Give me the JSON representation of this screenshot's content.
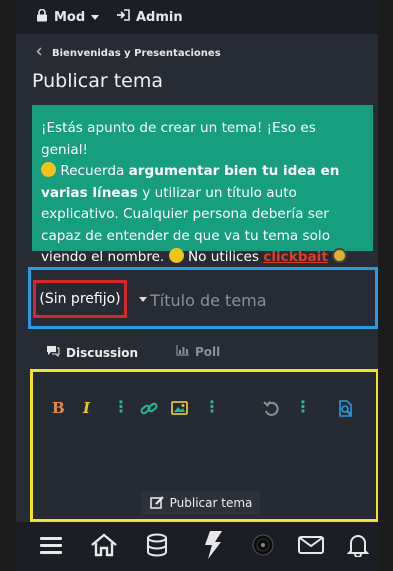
{
  "topbar": {
    "mod_label": "Mod",
    "admin_label": "Admin"
  },
  "breadcrumb": {
    "label": "Bienvenidas y Presentaciones"
  },
  "page": {
    "title": "Publicar tema"
  },
  "notice": {
    "part1": "¡Estás apunto de crear un tema! ¡Eso es genial!",
    "part2": " Recuerda ",
    "bold1": "argumentar bien tu idea en varias líneas",
    "part3": " y utilizar un título auto explicativo. Cualquier persona debería ser capaz de entender de que va tu tema solo viendo el nombre.",
    "part4": " No utilices ",
    "link": "clickbait"
  },
  "form": {
    "prefix_label": "(Sin prefijo)",
    "title_placeholder": "Título de tema"
  },
  "tabs": [
    {
      "label": "Discussion"
    },
    {
      "label": "Poll"
    }
  ],
  "editor": {
    "publish_label": "Publicar tema"
  },
  "colors": {
    "accent": "#169e7e",
    "link": "#e03c28",
    "highlight_blue": "#2a9be0",
    "highlight_red": "#d62828",
    "highlight_yellow": "#f5e02a"
  },
  "icons": [
    "lock-icon",
    "user-icon",
    "chevron-left-icon",
    "chart-icon",
    "bold-icon",
    "italic-icon",
    "link-icon",
    "image-icon",
    "undo-icon",
    "preview-icon",
    "edit-icon",
    "menu-icon",
    "home-icon",
    "database-icon",
    "bolt-icon",
    "vinyl-icon",
    "mail-icon",
    "bell-icon"
  ]
}
